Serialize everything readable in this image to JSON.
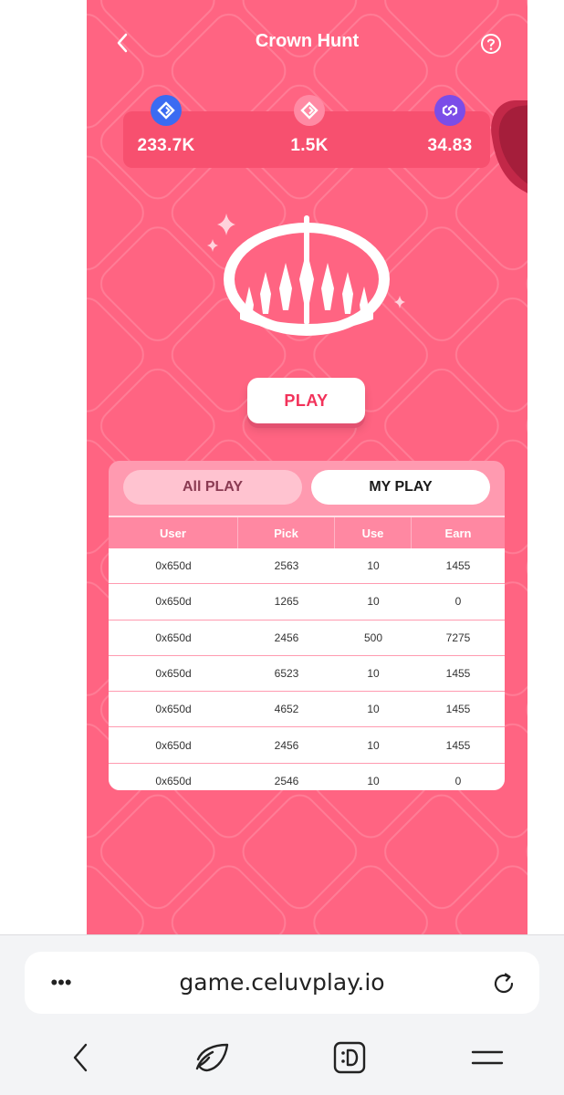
{
  "header": {
    "title": "Crown Hunt"
  },
  "stats": [
    {
      "value": "233.7K",
      "icon": "blue-diamond-token-icon",
      "color": "#3b6bf2"
    },
    {
      "value": "1.5K",
      "icon": "pink-diamond-token-icon",
      "color": "#ff8aa4"
    },
    {
      "value": "34.83",
      "icon": "polygon-token-icon",
      "color": "#7b4de8"
    }
  ],
  "play_button": "PLAY",
  "tabs": {
    "all_play": "All PLAY",
    "my_play": "MY PLAY"
  },
  "table": {
    "headers": [
      "User",
      "Pick",
      "Use",
      "Earn"
    ],
    "rows": [
      [
        "0x650d",
        "2563",
        "10",
        "1455"
      ],
      [
        "0x650d",
        "1265",
        "10",
        "0"
      ],
      [
        "0x650d",
        "2456",
        "500",
        "7275"
      ],
      [
        "0x650d",
        "6523",
        "10",
        "1455"
      ],
      [
        "0x650d",
        "4652",
        "10",
        "1455"
      ],
      [
        "0x650d",
        "2456",
        "10",
        "1455"
      ],
      [
        "0x650d",
        "2546",
        "10",
        "0"
      ]
    ]
  },
  "browser": {
    "url": "game.celuvplay.io",
    "menu_label": "•••"
  },
  "colors": {
    "app_bg": "#ff6482",
    "accent": "#f2325a"
  }
}
